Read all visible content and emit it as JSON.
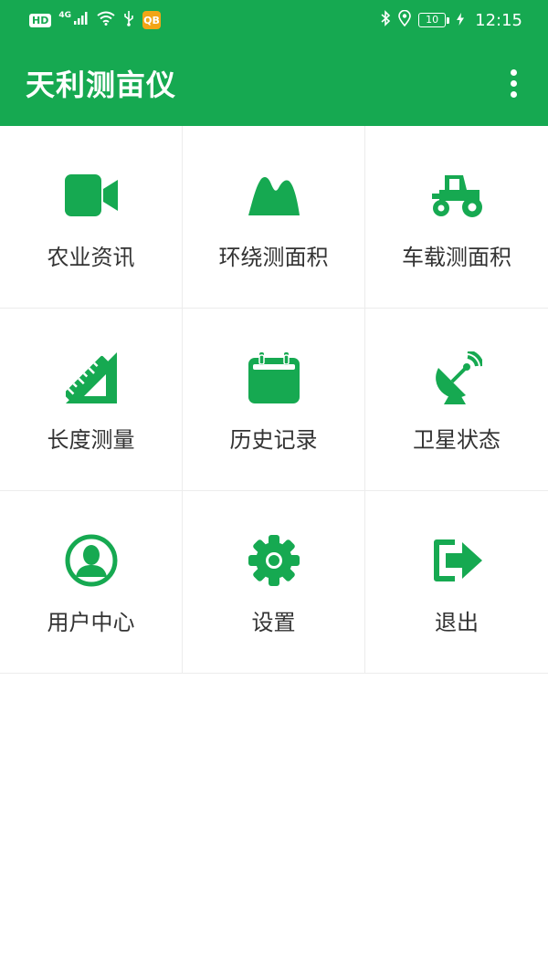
{
  "status_bar": {
    "hd": "HD",
    "network": "4G",
    "app_badge": "QB",
    "battery": "10",
    "time": "12:15"
  },
  "app_bar": {
    "title": "天利测亩仪"
  },
  "colors": {
    "primary": "#16a951",
    "text": "#333333",
    "divider": "#ececec"
  },
  "menu": [
    {
      "label": "农业资讯",
      "icon": "video-camera-icon"
    },
    {
      "label": "环绕测面积",
      "icon": "mountain-icon"
    },
    {
      "label": "车载测面积",
      "icon": "tractor-icon"
    },
    {
      "label": "长度测量",
      "icon": "ruler-icon"
    },
    {
      "label": "历史记录",
      "icon": "calendar-icon"
    },
    {
      "label": "卫星状态",
      "icon": "satellite-dish-icon"
    },
    {
      "label": "用户中心",
      "icon": "user-circle-icon"
    },
    {
      "label": "设置",
      "icon": "gear-icon"
    },
    {
      "label": "退出",
      "icon": "exit-icon"
    }
  ]
}
